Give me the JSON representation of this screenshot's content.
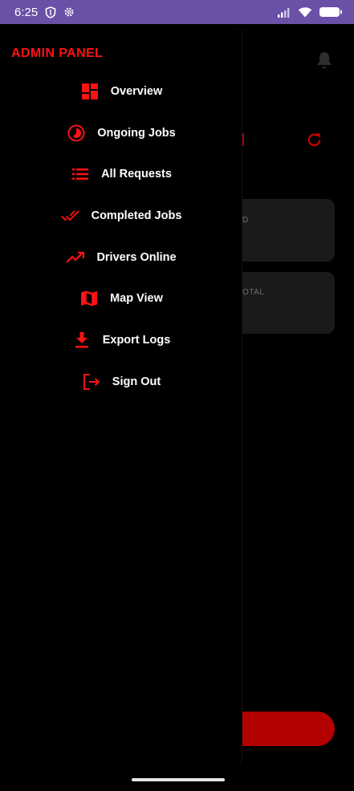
{
  "status_bar": {
    "time": "6:25",
    "icons": [
      "shield-icon",
      "settings-gear-icon",
      "signal-icon",
      "wifi-icon",
      "battery-icon"
    ]
  },
  "background_screen": {
    "card_1_label": "D",
    "card_2_label": "OTAL",
    "icons": [
      "bell-icon",
      "refresh-icon"
    ]
  },
  "drawer": {
    "title": "ADMIN PANEL",
    "items": [
      {
        "label": "Overview",
        "icon": "dashboard-icon"
      },
      {
        "label": "Ongoing Jobs",
        "icon": "timelapse-icon"
      },
      {
        "label": "All Requests",
        "icon": "list-icon"
      },
      {
        "label": "Completed Jobs",
        "icon": "done-all-icon"
      },
      {
        "label": "Drivers Online",
        "icon": "trending-up-icon"
      },
      {
        "label": "Map View",
        "icon": "map-icon"
      },
      {
        "label": "Export Logs",
        "icon": "download-icon"
      },
      {
        "label": "Sign Out",
        "icon": "logout-icon"
      }
    ]
  },
  "colors": {
    "accent": "#ff1212",
    "status_bar": "#6a50a7",
    "background": "#000000",
    "card": "#1a1a1a",
    "button": "#b30000"
  }
}
